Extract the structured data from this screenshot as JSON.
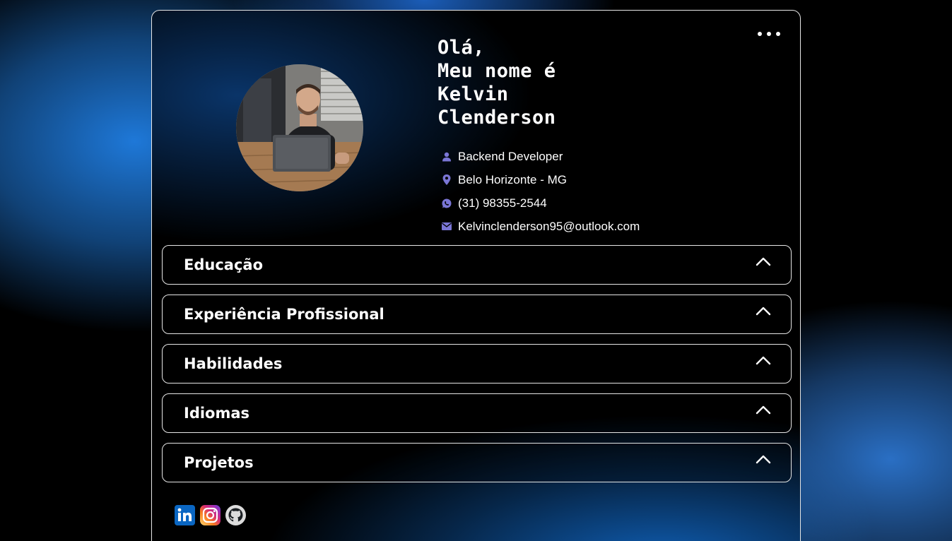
{
  "header": {
    "greeting_lines": [
      "Olá,",
      "Meu nome é",
      "Kelvin",
      "Clenderson"
    ],
    "menu_icon": "more-horizontal-icon"
  },
  "profile": {
    "photo_alt": "profile-photo"
  },
  "info": [
    {
      "icon": "person-icon",
      "text": "Backend Developer"
    },
    {
      "icon": "location-pin-icon",
      "text": "Belo Horizonte - MG"
    },
    {
      "icon": "whatsapp-icon",
      "text": "(31) 98355-2544"
    },
    {
      "icon": "mail-icon",
      "text": "Kelvinclenderson95@outlook.com"
    }
  ],
  "sections": [
    {
      "title": "Educação",
      "icon": "chevron-up-icon"
    },
    {
      "title": "Experiência Profissional",
      "icon": "chevron-up-icon"
    },
    {
      "title": "Habilidades",
      "icon": "chevron-up-icon"
    },
    {
      "title": "Idiomas",
      "icon": "chevron-up-icon"
    },
    {
      "title": "Projetos",
      "icon": "chevron-up-icon"
    }
  ],
  "social": [
    {
      "name": "linkedin",
      "icon": "linkedin-icon",
      "color": "#0a66c2"
    },
    {
      "name": "instagram",
      "icon": "instagram-icon",
      "color": "#e1306c"
    },
    {
      "name": "github",
      "icon": "github-icon",
      "color": "#24292e"
    }
  ],
  "colors": {
    "accent_icon": "#7a76d6",
    "border": "#e6e6e6",
    "background": "#000000",
    "glow": "#1e78d8"
  }
}
